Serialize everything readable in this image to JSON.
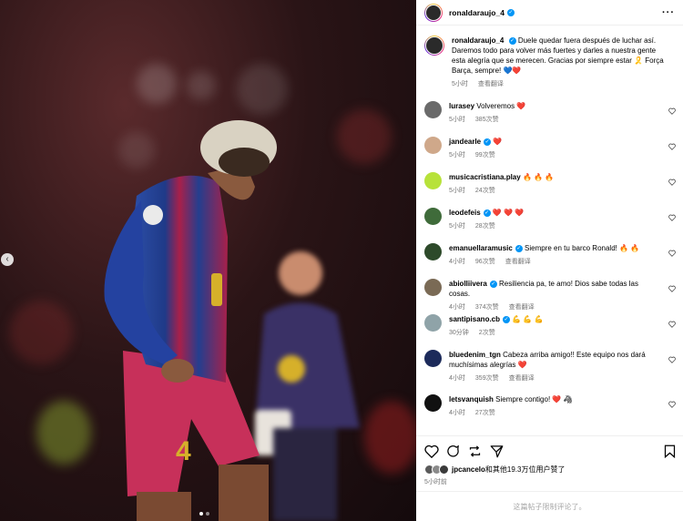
{
  "post": {
    "author": "ronaldaraujo_4",
    "author_icon": "verified-badge-icon"
  },
  "caption": {
    "username": "ronaldaraujo_4",
    "text": "Duele quedar fuera después de luchar así. Daremos todo para volver más fuertes y darles a nuestra gente esta alegría que se merecen. Gracias por siempre estar 🎗️ Força Barça, sempre! 💙❤️",
    "time": "5小时",
    "translate": "查看翻译"
  },
  "comments": [
    {
      "username": "lurasey",
      "verified": false,
      "text": "Volveremos ❤️",
      "time": "5小时",
      "likes": "385次赞",
      "translate": "",
      "avatar_color": "#6a6a6a"
    },
    {
      "username": "jandearle",
      "verified": true,
      "text": "❤️",
      "time": "5小时",
      "likes": "99次赞",
      "translate": "",
      "avatar_color": "#cfa88a"
    },
    {
      "username": "musicacristiana.play",
      "verified": false,
      "text": "🔥 🔥 🔥",
      "time": "5小时",
      "likes": "24次赞",
      "translate": "",
      "avatar_color": "#b7e23a"
    },
    {
      "username": "leodefeis",
      "verified": true,
      "text": "❤️ ❤️ ❤️",
      "time": "5小时",
      "likes": "28次赞",
      "translate": "",
      "avatar_color": "#3f6b3a"
    },
    {
      "username": "emanuellaramusic",
      "verified": true,
      "text": "Siempre en tu barco Ronald! 🔥 🔥",
      "time": "4小时",
      "likes": "96次赞",
      "translate": "查看翻译",
      "avatar_color": "#2d4a2a"
    },
    {
      "username": "abiolliivera",
      "verified": true,
      "text": "Resiliencia pa, te amo! Dios sabe todas las cosas.",
      "time": "4小时",
      "likes": "374次赞",
      "translate": "查看翻译",
      "avatar_color": "#7a6a55"
    },
    {
      "username": "santipisano.cb",
      "verified": true,
      "text": "💪 💪 💪",
      "time": "30分钟",
      "likes": "2次赞",
      "translate": "",
      "avatar_color": "#8fa3a8"
    },
    {
      "username": "bluedenim_tgn",
      "verified": false,
      "text": "Cabeza arriba amigo!! Este equipo nos dará muchísimas alegrías ❤️",
      "time": "4小时",
      "likes": "359次赞",
      "translate": "查看翻译",
      "avatar_color": "#1c2a5a"
    },
    {
      "username": "letsvanquish",
      "verified": false,
      "text": "Siempre contigo! ❤️ 🦓",
      "time": "4小时",
      "likes": "27次赞",
      "translate": "",
      "avatar_color": "#111111"
    }
  ],
  "actions": {
    "like_icon": "heart-icon",
    "comment_icon": "comment-icon",
    "share_icon": "repost-icon",
    "send_icon": "send-icon",
    "save_icon": "bookmark-icon"
  },
  "likes": {
    "text_user": "jpcancelo",
    "text_rest": "和其他19.3万位用户赞了"
  },
  "posted_time": "5小时前",
  "comments_limited": "这篇帖子限制评论了。",
  "colors": {
    "accent_blue": "#0095f6",
    "like_red": "#ff3040",
    "muted": "#737373"
  }
}
